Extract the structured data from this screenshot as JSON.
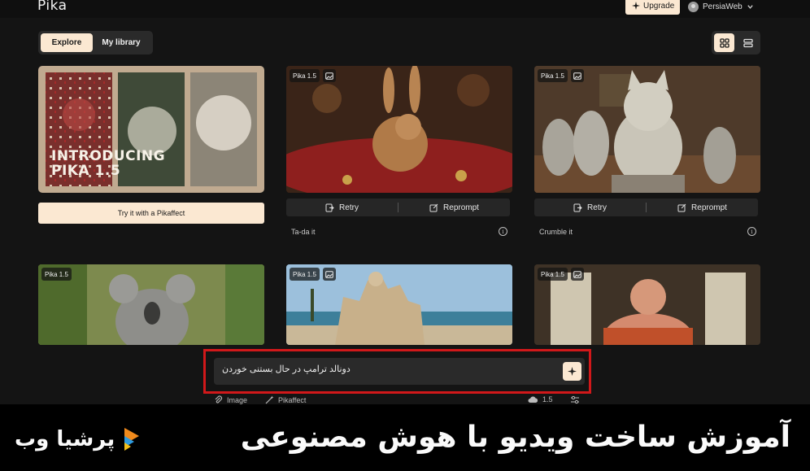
{
  "app": {
    "logo": "Pika",
    "upgrade_label": "Upgrade",
    "username": "PersiaWeb"
  },
  "tabs": [
    {
      "label": "Explore",
      "active": true
    },
    {
      "label": "My library",
      "active": false
    }
  ],
  "promo": {
    "title_line1": "INTRODUCING",
    "title_line2": "PIKA 1.5",
    "button_label": "Try it with a Pikaffect"
  },
  "cards": [
    {
      "badge": "Pika 1.5",
      "retry_label": "Retry",
      "reprompt_label": "Reprompt",
      "caption": "Ta-da it"
    },
    {
      "badge": "Pika 1.5",
      "retry_label": "Retry",
      "reprompt_label": "Reprompt",
      "caption": "Crumble it"
    },
    {
      "badge": "Pika 1.5"
    },
    {
      "badge": "Pika 1.5"
    },
    {
      "badge": "Pika 1.5"
    }
  ],
  "prompt": {
    "value": "دونالد ترامپ در حال بستنی خوردن"
  },
  "toolbar": {
    "image_label": "Image",
    "pikaffect_label": "Pikaffect",
    "model_label": "1.5"
  },
  "banner": {
    "title": "آموزش ساخت ویدیو با هوش مصنوعی",
    "brand": "پرشیا وب"
  },
  "colors": {
    "accent": "#fbe8d2",
    "highlight_outline": "#d1181a",
    "background": "#141414"
  }
}
